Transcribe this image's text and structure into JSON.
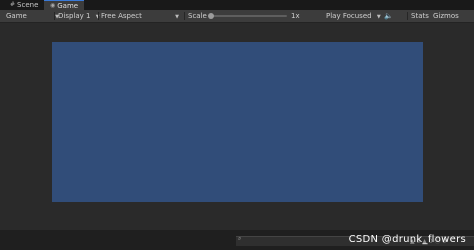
{
  "tabs": [
    {
      "label": "Scene",
      "icon": "grid-icon"
    },
    {
      "label": "Game",
      "icon": "gamepad-icon"
    }
  ],
  "toolbar": {
    "view_mode": "Game",
    "display": "Display 1",
    "aspect": "Free Aspect",
    "scale_label": "Scale",
    "scale_value": "1x",
    "play_mode": "Play Focused",
    "stats": "Stats",
    "gizmos": "Gizmos"
  },
  "viewport": {
    "camera_background_color": "#314d79"
  },
  "bottom": {
    "watermark": "CSDN @drunk_flowers",
    "icons": "▲ 0  ▲ 0  ⓘ 0"
  },
  "colors": {
    "accent": "#3a7ad8"
  }
}
